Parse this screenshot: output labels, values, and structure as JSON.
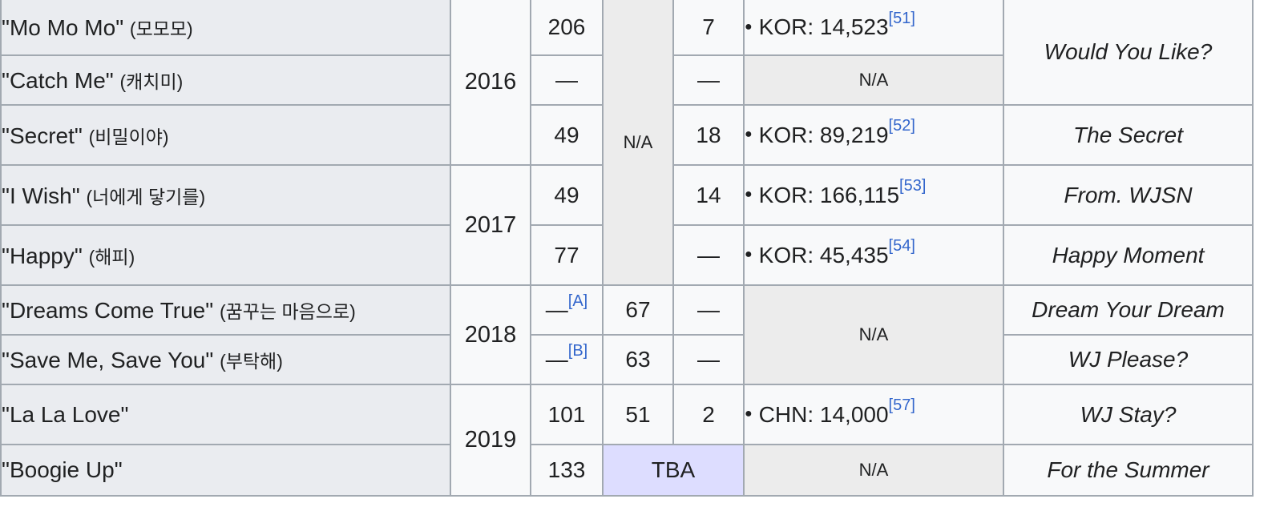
{
  "rows": [
    {
      "title": "\"Mo Mo Mo\"",
      "korean": "(모모모)",
      "year": "2016",
      "kor": "206",
      "jpn": "N/A",
      "us_world": "7",
      "cert_text": "KOR: 14,523",
      "cert_ref": "[51]",
      "album": "Would You Like?"
    },
    {
      "title": "\"Catch Me\"",
      "korean": "(캐치미)",
      "kor": "—",
      "us_world": "—",
      "cert_na": "N/A"
    },
    {
      "title": "\"Secret\"",
      "korean": "(비밀이야)",
      "kor": "49",
      "us_world": "18",
      "cert_text": "KOR: 89,219",
      "cert_ref": "[52]",
      "album": "The Secret"
    },
    {
      "title": "\"I Wish\"",
      "korean": "(너에게 닿기를)",
      "year": "2017",
      "kor": "49",
      "us_world": "14",
      "cert_text": "KOR: 166,115",
      "cert_ref": "[53]",
      "album": "From. WJSN"
    },
    {
      "title": "\"Happy\"",
      "korean": "(해피)",
      "kor": "77",
      "us_world": "—",
      "cert_text": "KOR: 45,435",
      "cert_ref": "[54]",
      "album": "Happy Moment"
    },
    {
      "title": "\"Dreams Come True\"",
      "korean": "(꿈꾸는 마음으로)",
      "year": "2018",
      "kor": "—",
      "kor_ref": "[A]",
      "jpn": "67",
      "us_world": "—",
      "cert_na": "N/A",
      "album": "Dream Your Dream"
    },
    {
      "title": "\"Save Me, Save You\"",
      "korean": "(부탁해)",
      "kor": "—",
      "kor_ref": "[B]",
      "jpn": "63",
      "us_world": "—",
      "album": "WJ Please?"
    },
    {
      "title": "\"La La Love\"",
      "korean": "",
      "year": "2019",
      "kor": "101",
      "jpn": "51",
      "us_world": "2",
      "cert_text": "CHN: 14,000",
      "cert_ref": "[57]",
      "album": "WJ Stay?"
    },
    {
      "title": "\"Boogie Up\"",
      "korean": "",
      "kor": "133",
      "tba": "TBA",
      "cert_na": "N/A",
      "album": "For the Summer"
    }
  ],
  "colors": {
    "header": "#eaecf0",
    "cell": "#f8f9fa",
    "na": "#ececec",
    "tba": "#ddddff",
    "link": "#3366cc",
    "border": "#a2a9b1"
  }
}
